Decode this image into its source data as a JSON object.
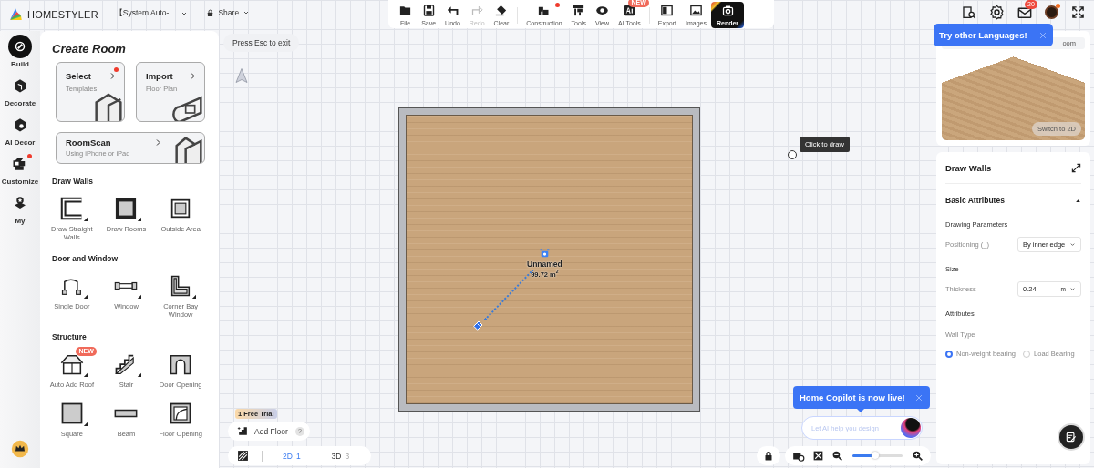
{
  "header": {
    "logo": "HOMESTYLER",
    "document_title": "【System Auto-...",
    "share": "Share"
  },
  "toolbar": [
    {
      "kind": "file",
      "label": "File",
      "disabled": false,
      "dot": false
    },
    {
      "kind": "save",
      "label": "Save",
      "disabled": false,
      "dot": false
    },
    {
      "kind": "undo",
      "label": "Undo",
      "disabled": false,
      "dot": false
    },
    {
      "kind": "redo",
      "label": "Redo",
      "disabled": true,
      "dot": false
    },
    {
      "kind": "clear",
      "label": "Clear",
      "disabled": false,
      "dot": false,
      "group_end": true
    },
    {
      "kind": "construction",
      "label": "Construction",
      "disabled": false,
      "dot": true
    },
    {
      "kind": "tools",
      "label": "Tools",
      "disabled": false,
      "dot": false
    },
    {
      "kind": "view",
      "label": "View",
      "disabled": false,
      "dot": false
    },
    {
      "kind": "ai",
      "label": "AI Tools",
      "disabled": false,
      "dot": false,
      "badge": "NEW",
      "group_end": true
    },
    {
      "kind": "export",
      "label": "Export",
      "disabled": false,
      "dot": false
    },
    {
      "kind": "images",
      "label": "Images",
      "disabled": false,
      "dot": false
    },
    {
      "kind": "render",
      "label": "Render",
      "disabled": false,
      "dot": false
    }
  ],
  "top_right": {
    "notification_count": "20",
    "avatar_dot": true
  },
  "left_rail": [
    {
      "kind": "build",
      "label": "Build",
      "selected": true,
      "dot": false
    },
    {
      "kind": "decorate",
      "label": "Decorate",
      "selected": false,
      "dot": false
    },
    {
      "kind": "ai",
      "label": "AI Decor",
      "selected": false,
      "dot": false
    },
    {
      "kind": "customize",
      "label": "Customize",
      "selected": false,
      "dot": true
    },
    {
      "kind": "my",
      "label": "My",
      "selected": false,
      "dot": false
    }
  ],
  "create_room": {
    "title": "Create Room",
    "cards": [
      {
        "kind": "select",
        "title": "Select",
        "subtitle": "Templates",
        "dot": true
      },
      {
        "kind": "import",
        "title": "Import",
        "subtitle": "Floor Plan",
        "dot": false
      },
      {
        "kind": "scan",
        "title": "RoomScan",
        "subtitle": "Using iPhone or iPad",
        "dot": false
      }
    ],
    "sections": [
      {
        "title": "Draw Walls",
        "tools": [
          {
            "kind": "straight",
            "label": "Draw Straight Walls",
            "submenu": true
          },
          {
            "kind": "rooms",
            "label": "Draw Rooms",
            "submenu": true
          },
          {
            "kind": "outside",
            "label": "Outside Area",
            "submenu": false
          }
        ]
      },
      {
        "title": "Door and Window",
        "tools": [
          {
            "kind": "door",
            "label": "Single Door",
            "submenu": true
          },
          {
            "kind": "window",
            "label": "Window",
            "submenu": true
          },
          {
            "kind": "bay",
            "label": "Corner Bay Window",
            "submenu": true
          }
        ]
      },
      {
        "title": "Structure",
        "tools": [
          {
            "kind": "roof",
            "label": "Auto Add Roof",
            "submenu": true,
            "badge": "NEW"
          },
          {
            "kind": "stair",
            "label": "Stair",
            "submenu": true
          },
          {
            "kind": "opening",
            "label": "Door Opening",
            "submenu": false
          },
          {
            "kind": "square",
            "label": "Square",
            "submenu": true
          },
          {
            "kind": "beam",
            "label": "Beam",
            "submenu": false
          },
          {
            "kind": "floor-opening",
            "label": "Floor Opening",
            "submenu": false
          }
        ]
      }
    ]
  },
  "canvas": {
    "hint": "Press Esc to exit",
    "tooltip": "Click to draw",
    "room": {
      "name": "Unnamed",
      "area": "99.72 m$^{2}$"
    }
  },
  "floor_controls": {
    "trial_badge": "1 Free Trial",
    "add_floor": "Add Floor",
    "help": "?",
    "views": [
      {
        "label": "2D",
        "count": "1",
        "selected": true
      },
      {
        "label": "3D",
        "count": "3",
        "selected": false
      }
    ]
  },
  "zoom": {
    "level": 0.45
  },
  "copilot": {
    "banner": "Home Copilot is now live!",
    "placeholder": "Let AI help you design"
  },
  "language_tip": {
    "text": "Try other Languages!"
  },
  "preview": {
    "tab_label": "oom",
    "switch_button": "Switch to 2D"
  },
  "properties": {
    "title": "Draw Walls",
    "section": {
      "title": "Basic Attributes",
      "expanded": true,
      "groups": [
        {
          "title": "Drawing Parameters",
          "fields": [
            {
              "kind": "select",
              "label": "Positioning (_)",
              "value": "By inner edge"
            }
          ]
        },
        {
          "title": "Size",
          "fields": [
            {
              "kind": "number",
              "label": "Thickness",
              "value": "0.24",
              "unit": "m"
            }
          ]
        },
        {
          "title": "Attributes",
          "fields": [
            {
              "kind": "radio",
              "label": "Wall Type",
              "options": [
                {
                  "label": "Non-weight bearing",
                  "selected": true
                },
                {
                  "label": "Load Bearing",
                  "selected": false
                }
              ]
            }
          ]
        }
      ]
    }
  }
}
